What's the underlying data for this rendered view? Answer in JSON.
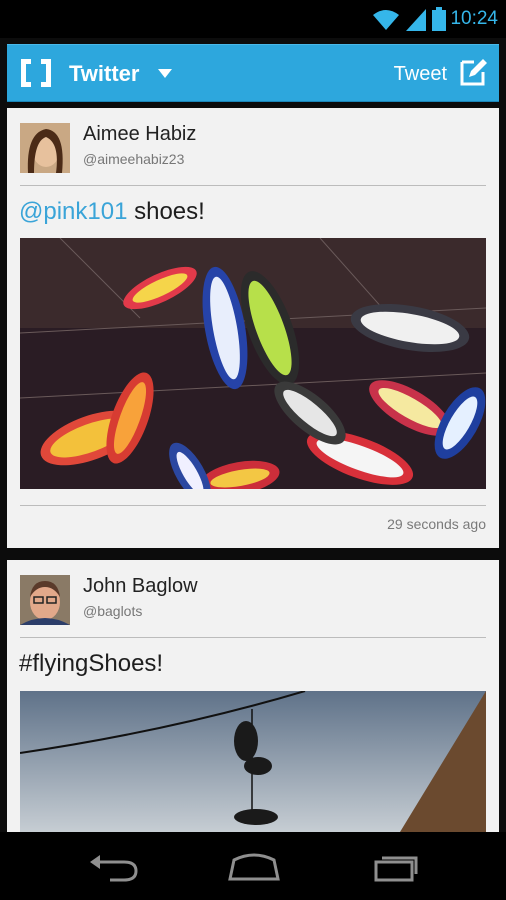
{
  "status_bar": {
    "time": "10:24",
    "icons": [
      "wifi-icon",
      "signal-icon",
      "battery-icon"
    ]
  },
  "action_bar": {
    "app_name": "Twitter",
    "tweet_label": "Tweet",
    "color": "#2da7dd"
  },
  "tweets": [
    {
      "name": "Aimee Habiz",
      "handle": "@aimeehabiz23",
      "mention": "@pink101",
      "text": " shoes!",
      "timestamp": "29 seconds ago"
    },
    {
      "name": "John Baglow",
      "handle": "@baglots",
      "text": "#flyingShoes!"
    }
  ],
  "colors": {
    "mention": "#3aa4d8",
    "status_time": "#35b6ea"
  }
}
